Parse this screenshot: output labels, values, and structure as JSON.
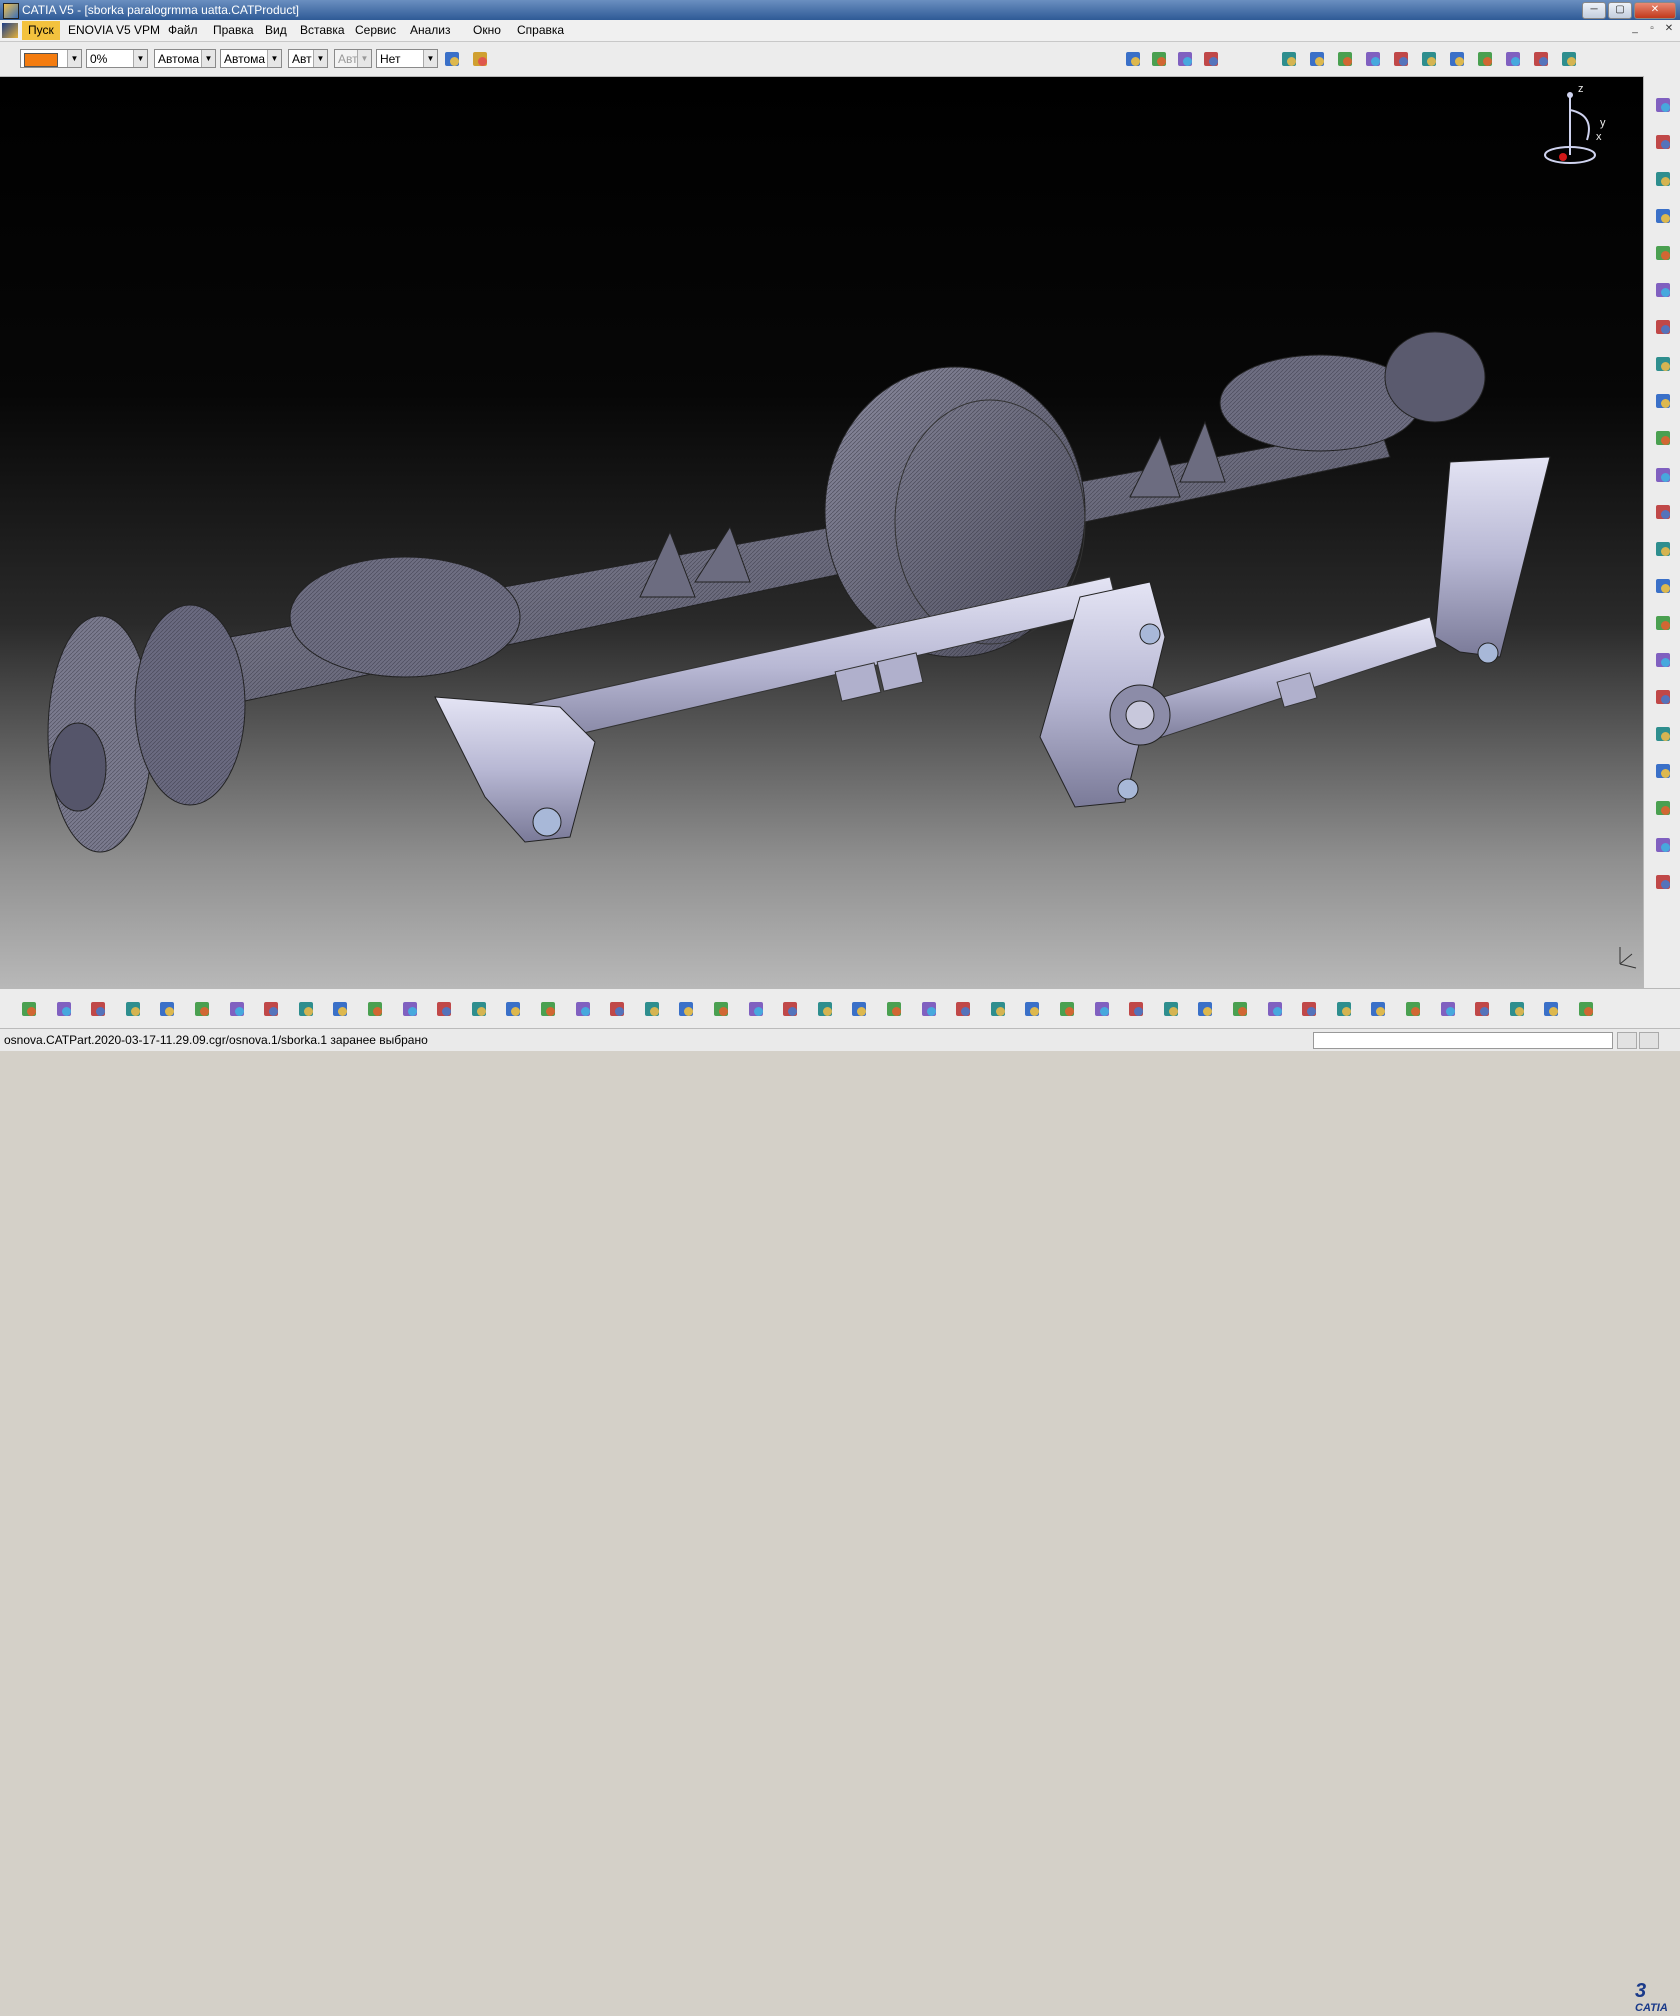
{
  "window": {
    "title": "CATIA V5 - [sborka paralogrmma uatta.CATProduct]",
    "buttons": [
      "─",
      "▢",
      "✕"
    ]
  },
  "menubar": {
    "items": [
      "Пуск",
      "ENOVIA V5 VPM",
      "Файл",
      "Правка",
      "Вид",
      "Вставка",
      "Сервис",
      "Анализ",
      "Окно",
      "Справка"
    ],
    "mdi_buttons": [
      "_",
      "▫",
      "✕"
    ]
  },
  "graphic_properties": {
    "fill_color": "#f47c10",
    "transparency": "0%",
    "line_thickness": "Автома",
    "line_type": "Автома",
    "point_type": "Авт",
    "layer_disabled": "Авт",
    "layer": "Нет"
  },
  "viewport": {
    "compass": {
      "z": "z",
      "y": "y",
      "x": "x"
    },
    "background_top": "#000000",
    "background_bottom": "#b8b8b8",
    "part_color": "#b8b8d8"
  },
  "status": {
    "message": "osnova.CATPart.2020-03-17-11.29.09.cgr/osnova.1/sborka.1 заранее выбрано",
    "input_value": ""
  },
  "logo": {
    "text": "CATIA"
  },
  "icons": {
    "top_right": [
      "product-icon",
      "tree-icon",
      "catalog-icon",
      "catalog2-icon",
      "constraint-icon",
      "component-icon",
      "part-icon",
      "move-icon",
      "snap-icon",
      "explode-icon",
      "clash-icon",
      "section-icon",
      "distance-icon",
      "update-icon",
      "scene-icon"
    ],
    "right": [
      "assembly-constraints-icon",
      "product-structure-icon",
      "component-icon",
      "new-part-icon",
      "existing-component-icon",
      "replace-component-icon",
      "graph-icon",
      "renumber-icon",
      "bill-of-material-icon",
      "generate-numbering-icon",
      "selective-load-icon",
      "manage-representation-icon",
      "multi-instantiation-icon",
      "select-icon",
      "manipulate-icon",
      "snap-icon",
      "explode-icon",
      "stop-manipulate-icon",
      "fix-icon",
      "coincidence-icon",
      "contact-icon",
      "offset-icon"
    ],
    "bottom": [
      "select-icon",
      "new-icon",
      "open-icon",
      "save-icon",
      "print-icon",
      "cut-icon",
      "copy-icon",
      "paste-icon",
      "undo-icon",
      "redo-icon",
      "whats-this-icon",
      "search-icon",
      "formula-icon",
      "comment-icon",
      "light-icon",
      "table-icon",
      "tree-icon",
      "lock-icon",
      "multi-view-icon",
      "fly-icon",
      "fit-all-icon",
      "pan-icon",
      "rotate-icon",
      "zoom-in-icon",
      "zoom-out-icon",
      "normal-view-icon",
      "multi-view-icon",
      "iso-view-icon",
      "shading-icon",
      "hide-show-icon",
      "swap-space-icon",
      "publication-icon",
      "capture-icon",
      "update-icon",
      "measure-icon",
      "measure-item-icon",
      "measure-inertia-icon",
      "gear-icon",
      "kinematics-icon",
      "simulation-icon",
      "sketch-icon",
      "sequence-icon",
      "camera-icon",
      "render-icon",
      "catalog-icon",
      "hand-icon"
    ]
  }
}
